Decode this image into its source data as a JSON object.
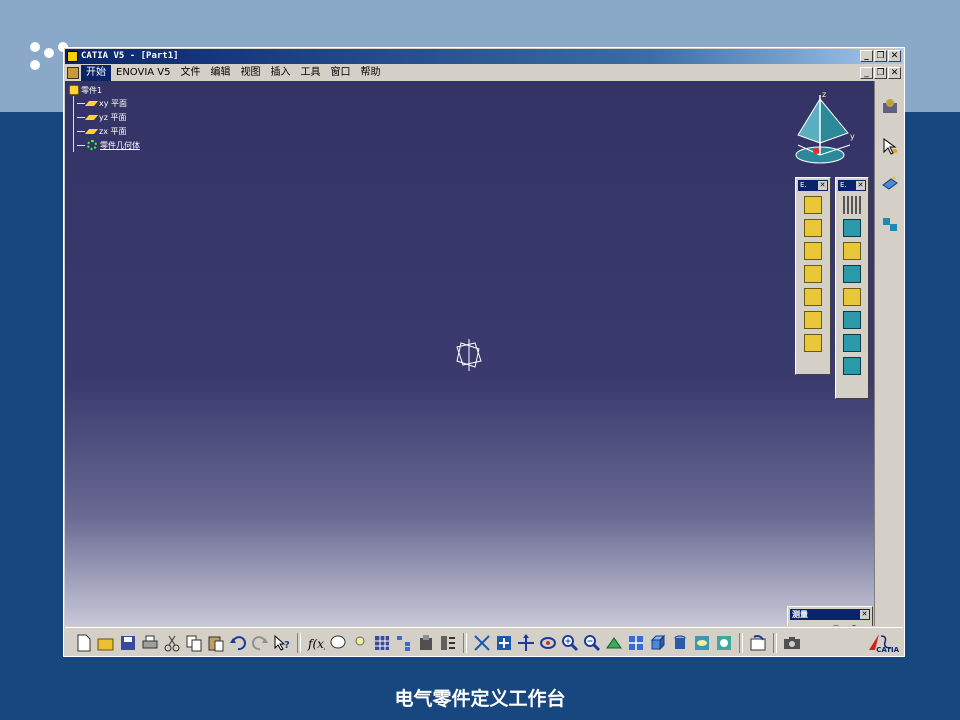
{
  "window": {
    "title": "CATIA V5 - [Part1]",
    "minimize": "_",
    "restore": "❐",
    "close": "✕"
  },
  "menubar": {
    "items": [
      "开始",
      "ENOVIA V5",
      "文件",
      "编辑",
      "视图",
      "插入",
      "工具",
      "窗口",
      "帮助"
    ],
    "active_index": 0
  },
  "tree": {
    "root": "零件1",
    "items": [
      "xy 平面",
      "yz 平面",
      "zx 平面"
    ],
    "body": "零件几何体"
  },
  "compass": {
    "z_label": "z",
    "y_label": "y"
  },
  "floating_toolbars": [
    {
      "title": "E.",
      "close": "✕",
      "icon_count": 7
    },
    {
      "title": "E.",
      "close": "✕",
      "icon_count": 8
    }
  ],
  "measure_toolbar": {
    "title": "测量",
    "close": "✕"
  },
  "bottom_toolbar": {
    "icons": [
      "new-icon",
      "open-icon",
      "save-icon",
      "print-icon",
      "cut-icon",
      "copy-icon",
      "paste-icon",
      "undo-icon",
      "redo-icon",
      "whats-this-icon",
      "formula-icon",
      "knowledge-icon",
      "light-icon",
      "table-icon",
      "tree-icon",
      "catalog-icon",
      "param-icon",
      "fit-all-icon",
      "pan-icon",
      "rotate-icon",
      "fly-icon",
      "zoom-in-icon",
      "zoom-out-icon",
      "normal-view-icon",
      "multi-view-icon",
      "iso-view-icon",
      "shading-icon",
      "hide-show-icon",
      "swap-icon",
      "update-icon",
      "camera-icon"
    ],
    "logo_text": "CATIA"
  },
  "caption": "电气零件定义工作台",
  "colors": {
    "background": "#17477e",
    "top_band": "#8aa8c8",
    "viewport_top": "#333366",
    "titlebar": "#0a246a"
  }
}
